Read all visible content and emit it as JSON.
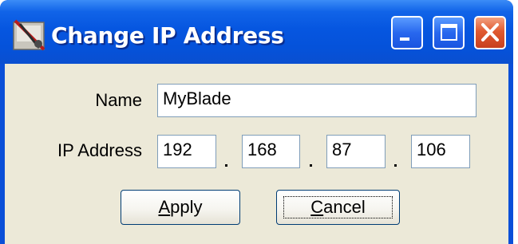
{
  "window": {
    "title": "Change IP Address",
    "titlebar_color": "#0656e0",
    "client_color": "#ece9d8",
    "icons": {
      "app": "network-tool-icon",
      "minimize": "minimize-icon",
      "maximize": "maximize-icon",
      "close": "close-icon"
    }
  },
  "form": {
    "name_label": "Name",
    "name_value": "MyBlade",
    "ip_label": "IP Address",
    "ip_octets": [
      "192",
      "168",
      "87",
      "106"
    ]
  },
  "buttons": {
    "apply": {
      "mnemonic": "A",
      "rest": "pply"
    },
    "cancel": {
      "mnemonic": "C",
      "rest": "ancel"
    }
  }
}
